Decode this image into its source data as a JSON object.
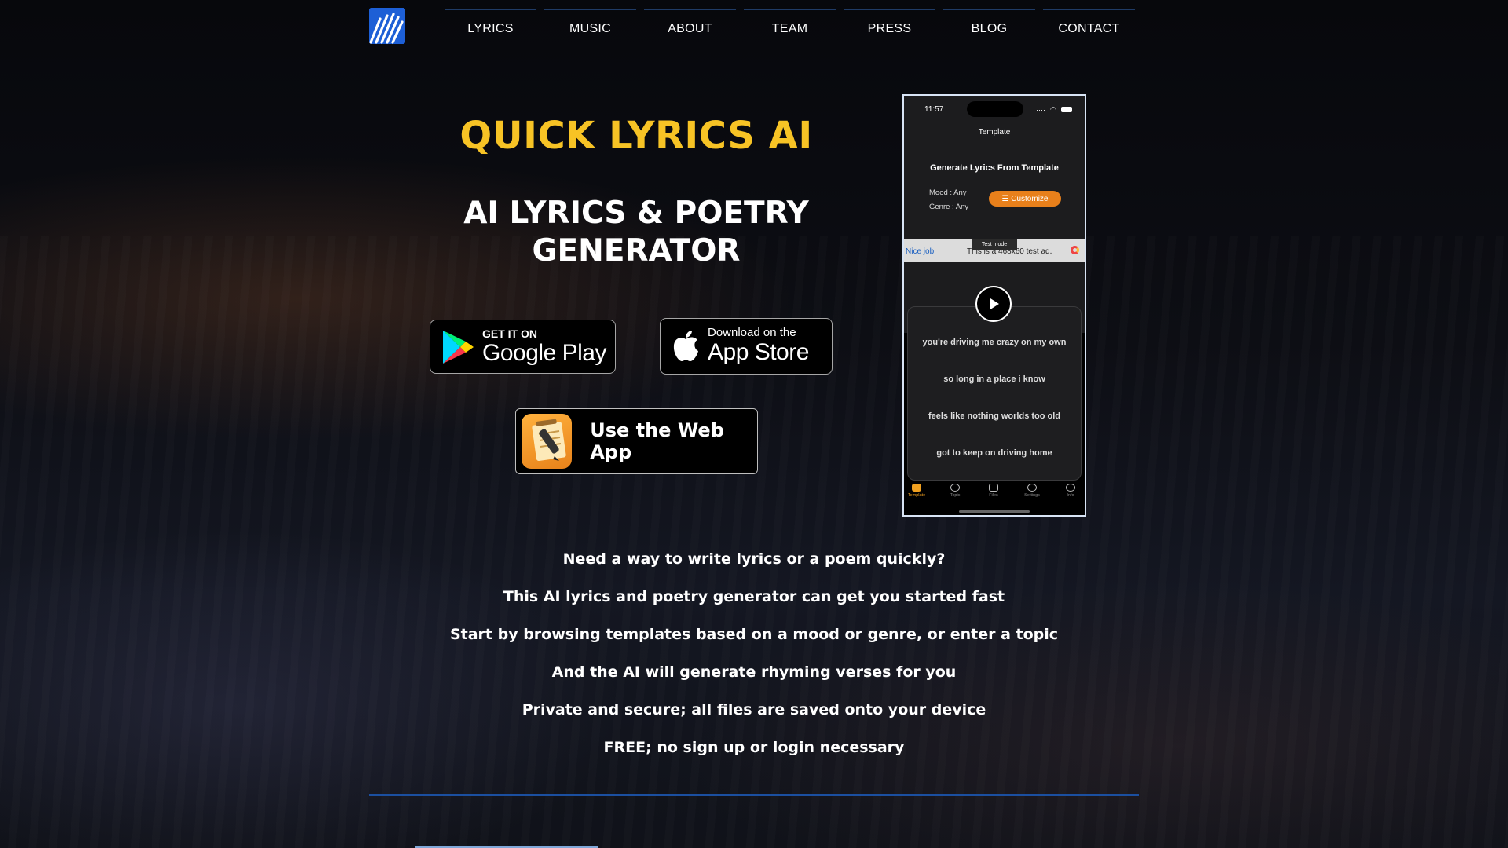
{
  "nav": {
    "items": [
      "LYRICS",
      "MUSIC",
      "ABOUT",
      "TEAM",
      "PRESS",
      "BLOG",
      "CONTACT"
    ]
  },
  "hero": {
    "title": "QUICK LYRICS AI",
    "subtitle_line1": "AI LYRICS & POETRY",
    "subtitle_line2": "GENERATOR"
  },
  "stores": {
    "google_small": "GET IT ON",
    "google_big": "Google Play",
    "apple_small": "Download on the",
    "apple_big": "App Store",
    "web_app": "Use the Web App"
  },
  "phone": {
    "time": "11:57",
    "nav_title": "Template",
    "card_title": "Generate Lyrics From Template",
    "mood": "Mood : Any",
    "genre": "Genre : Any",
    "customize": "☰ Customize",
    "ad_test_mode": "Test mode",
    "ad_nice": "Nice job!",
    "ad_text": "This is a 468x60 test ad.",
    "lyrics": [
      "you're driving me crazy on my own",
      "so long in a place i know",
      "feels like nothing worlds too old",
      "got to keep on driving home"
    ],
    "tabs": [
      "Template",
      "Topic",
      "Files",
      "Settings",
      "Info"
    ]
  },
  "description": [
    "Need a way to write lyrics or a poem quickly?",
    "This AI lyrics and poetry generator can get you started fast",
    "Start by browsing templates based on a mood or genre, or enter a topic",
    "And the AI will generate rhyming verses for you",
    "Private and secure; all files are saved onto your device",
    "FREE; no sign up or login necessary"
  ],
  "colors": {
    "accent_yellow": "#f7c325",
    "nav_blue": "#1b4fa0",
    "customize_orange": "#e8801b"
  }
}
